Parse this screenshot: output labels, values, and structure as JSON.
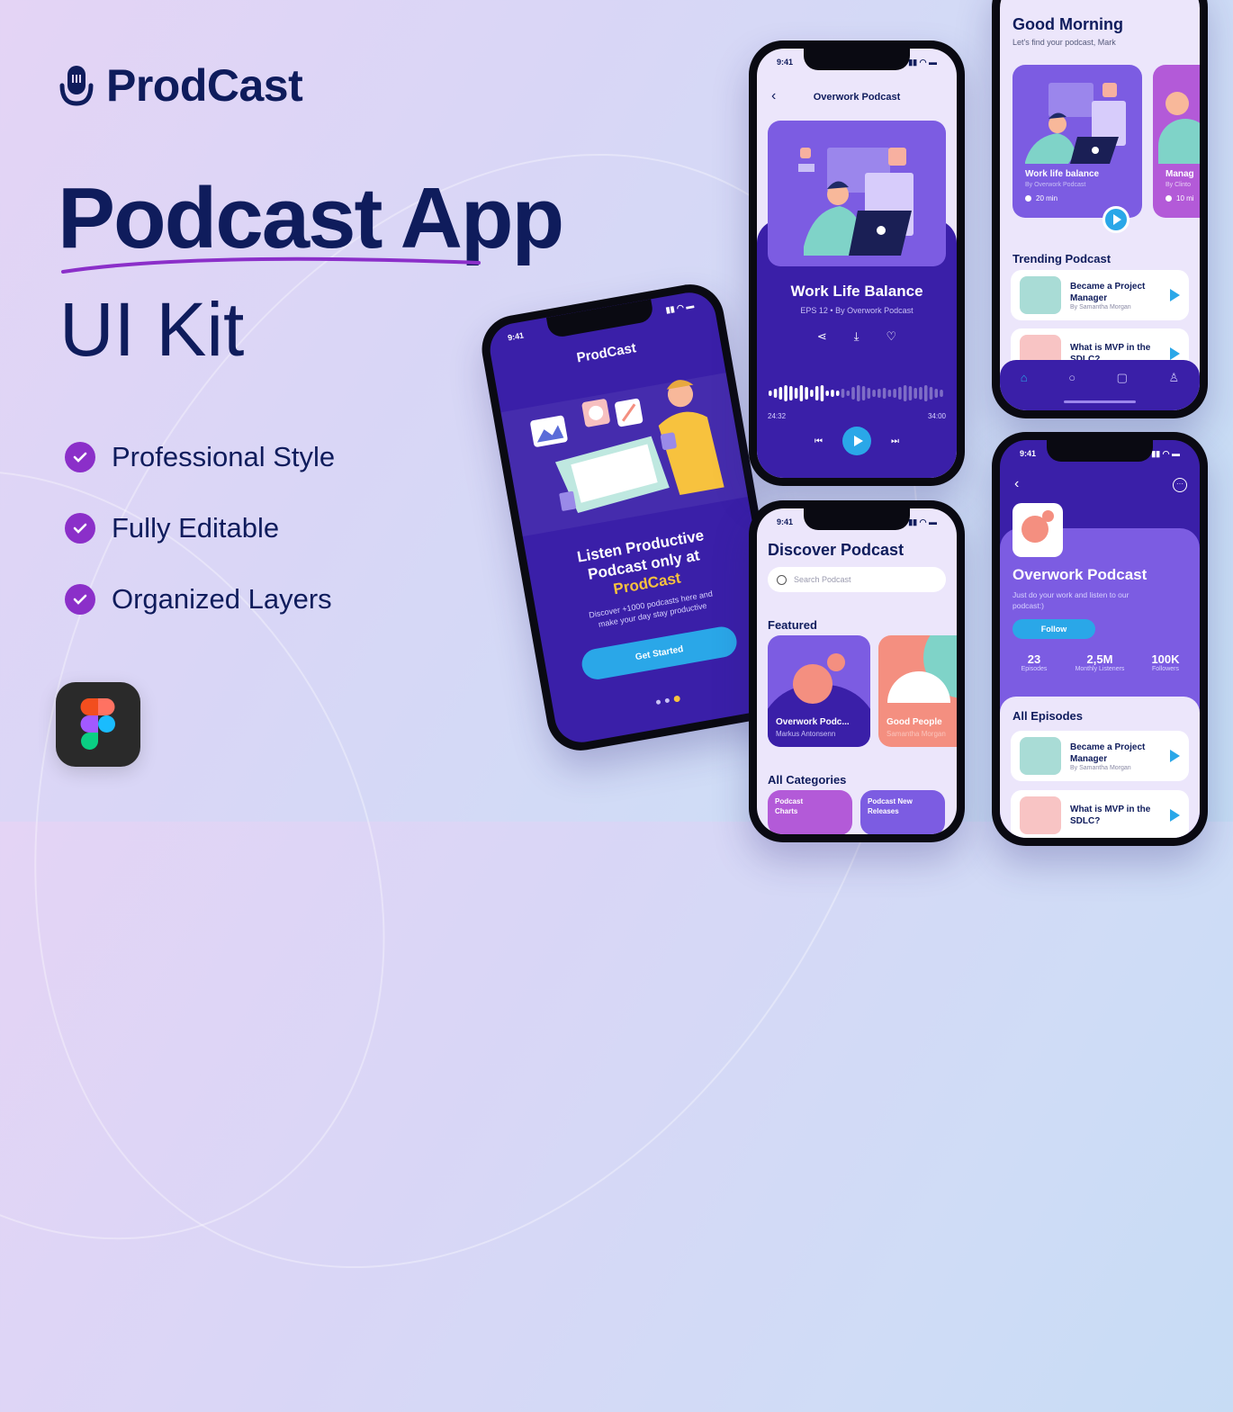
{
  "brand": {
    "name": "ProdCast",
    "icon": "microphone-icon"
  },
  "headline": {
    "line1": "Podcast App",
    "line2": "UI Kit"
  },
  "features": [
    {
      "label": "Professional Style",
      "icon": "check-circle-icon"
    },
    {
      "label": "Fully Editable",
      "icon": "check-circle-icon"
    },
    {
      "label": "Organized Layers",
      "icon": "check-circle-icon"
    }
  ],
  "tool_badge": {
    "icon": "figma-logo-icon"
  },
  "colors": {
    "navy": "#0f1c5c",
    "purple_accent": "#8b2fc9",
    "deep_purple": "#3a1fa8",
    "mid_purple": "#7c5ce2",
    "sky": "#2aa7e8",
    "yellow": "#f7c23e",
    "coral": "#f48f80",
    "mint": "#7fd3c8"
  },
  "status_bar": {
    "time": "9:41"
  },
  "onboarding": {
    "app_title": "ProdCast",
    "headline_1": "Listen Productive",
    "headline_2": "Podcast only at",
    "headline_brand": "ProdCast",
    "subtitle_1": "Discover +1000 podcasts here and",
    "subtitle_2": "make your day stay productive",
    "cta": "Get Started",
    "page_dots": 3,
    "active_dot": 3
  },
  "player": {
    "header_title": "Overwork Podcast",
    "episode_title": "Work Life Balance",
    "episode_meta": "EPS 12 • By Overwork Podcast",
    "actions": [
      "share-icon",
      "download-icon",
      "heart-icon"
    ],
    "elapsed": "24:32",
    "duration": "34:00",
    "progress": 0.72
  },
  "discover": {
    "title": "Discover Podcast",
    "search_placeholder": "Search Podcast",
    "featured_label": "Featured",
    "featured": [
      {
        "title": "Overwork Podc...",
        "author": "Markus Antonsenn"
      },
      {
        "title": "Good People",
        "author": "Samantha Morgan"
      }
    ],
    "categories_label": "All Categories",
    "categories": [
      {
        "label_1": "Podcast",
        "label_2": "Charts"
      },
      {
        "label_1": "Podcast New",
        "label_2": "Releases"
      }
    ]
  },
  "home": {
    "greeting": "Good Morning",
    "subtitle": "Let's find your podcast, Mark",
    "cards": [
      {
        "title": "Work life balance",
        "by": "By Overwork Podcast",
        "duration": "20 min"
      },
      {
        "title": "Manag",
        "by": "By Clinto",
        "duration": "10 mi"
      }
    ],
    "trending_label": "Trending Podcast",
    "trending": [
      {
        "title_1": "Became a Project",
        "title_2": "Manager",
        "by": "By Samantha Morgan"
      },
      {
        "title_1": "What is MVP in the",
        "title_2": "SDLC?",
        "by": ""
      }
    ],
    "nav": [
      "home-icon",
      "search-icon",
      "library-icon",
      "profile-icon"
    ]
  },
  "channel": {
    "name": "Overwork Podcast",
    "description_1": "Just do your work and listen to our",
    "description_2": "podcast:)",
    "follow": "Follow",
    "stats": [
      {
        "value": "23",
        "label": "Episodes"
      },
      {
        "value": "2,5M",
        "label": "Monthly Listeners"
      },
      {
        "value": "100K",
        "label": "Followers"
      }
    ],
    "episodes_label": "All Episodes",
    "episodes": [
      {
        "title_1": "Became a Project",
        "title_2": "Manager",
        "by": "By Samantha Morgan"
      },
      {
        "title_1": "What is MVP in the",
        "title_2": "SDLC?",
        "by": ""
      }
    ]
  }
}
